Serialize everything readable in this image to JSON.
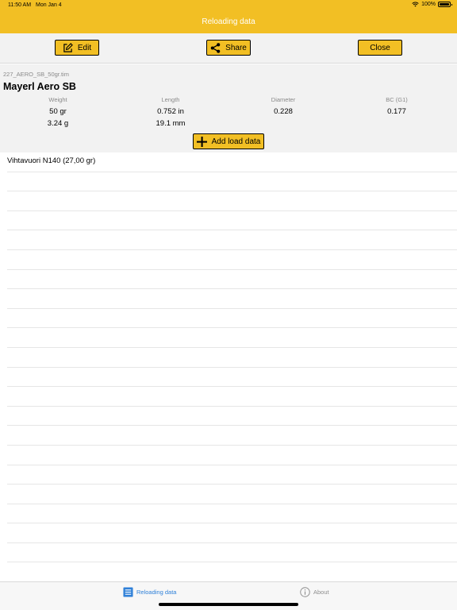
{
  "status_bar": {
    "time": "11:50 AM",
    "date": "Mon Jan 4",
    "battery": "100%"
  },
  "nav": {
    "title": "Reloading data"
  },
  "toolbar": {
    "edit_label": "Edit",
    "share_label": "Share",
    "close_label": "Close"
  },
  "bullet": {
    "filename": "227_AERO_SB_50gr.tim",
    "name": "Mayerl Aero SB",
    "weight_label": "Weight",
    "weight_gr": "50 gr",
    "weight_g": "3.24 g",
    "length_label": "Length",
    "length_in": "0.752 in",
    "length_mm": "19.1 mm",
    "diameter_label": "Diameter",
    "diameter": "0.228",
    "bc_label": "BC (G1)",
    "bc": "0.177"
  },
  "add_button_label": "Add load data",
  "loads": [
    "Vihtavuori N140 (27,00 gr)"
  ],
  "tabs": {
    "reloading": "Reloading data",
    "about": "About"
  },
  "colors": {
    "accent": "#f2bf24",
    "tab_active": "#2f80d8",
    "tab_inactive": "#8e8e8e"
  },
  "icons": [
    "wifi-icon",
    "battery-icon",
    "edit-icon",
    "share-icon",
    "plus-icon",
    "list-icon",
    "info-icon"
  ]
}
